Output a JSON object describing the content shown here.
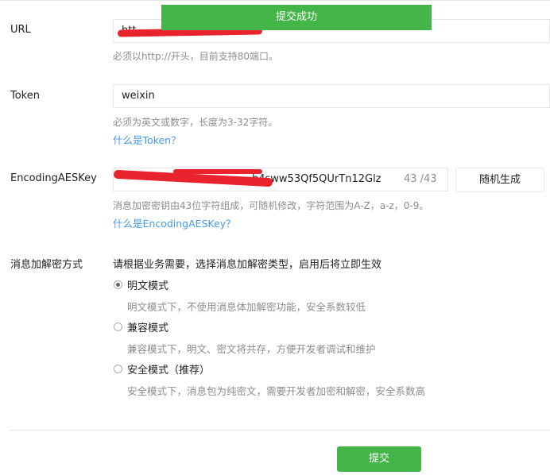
{
  "toast": {
    "text": "提交成功"
  },
  "url": {
    "label": "URL",
    "value": "htt",
    "hint": "必须以http://开头，目前支持80端口。"
  },
  "token": {
    "label": "Token",
    "value": "weixin",
    "hint": "必须为英文或数字，长度为3-32字符。",
    "help_link": "什么是Token？"
  },
  "aes": {
    "label": "EncodingAESKey",
    "value_visible": "b4sww53Qf5QUrTn12Glz",
    "counter": "43 /43",
    "random_button": "随机生成",
    "hint": "消息加密密钥由43位字符组成，可随机修改，字符范围为A-Z，a-z，0-9。",
    "help_link": "什么是EncodingAESKey？"
  },
  "encrypt": {
    "label": "消息加解密方式",
    "intro": "请根据业务需要，选择消息加解密类型，启用后将立即生效",
    "options": [
      {
        "label": "明文模式",
        "desc": "明文模式下，不使用消息体加解密功能，安全系数较低",
        "checked": true
      },
      {
        "label": "兼容模式",
        "desc": "兼容模式下，明文、密文将共存，方便开发者调试和维护",
        "checked": false
      },
      {
        "label": "安全模式（推荐）",
        "desc": "安全模式下，消息包为纯密文，需要开发者加密和解密，安全系数高",
        "checked": false
      }
    ]
  },
  "submit": {
    "label": "提交"
  },
  "colors": {
    "accent": "#44b549",
    "link": "#459ae9",
    "hint": "#8d8d8d",
    "redaction": "#e8232e"
  }
}
